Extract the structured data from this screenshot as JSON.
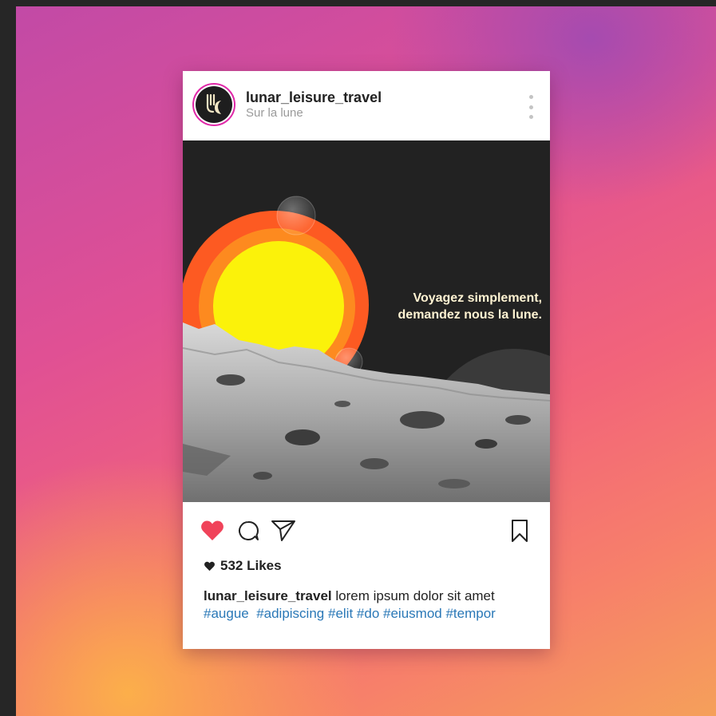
{
  "post": {
    "username": "lunar_leisure_travel",
    "location": "Sur la lune",
    "image": {
      "slogan_line1": "Voyagez simplement,",
      "slogan_line2": "demandez nous la lune."
    },
    "likes": "532 Likes",
    "caption": {
      "username": "lunar_leisure_travel",
      "text": "lorem ipsum dolor sit amet",
      "hashtags": [
        "#augue",
        "#adipiscing",
        "#elit",
        "#do",
        "#eiusmod",
        "#tempor"
      ]
    }
  },
  "icons": {
    "more": "more-vertical-icon",
    "like": "heart-icon",
    "comment": "comment-icon",
    "share": "send-icon",
    "save": "bookmark-icon",
    "likes_marker": "heart-small-icon"
  },
  "colors": {
    "like_active": "#f0435a",
    "hashtag": "#2a78b7",
    "avatar_ring": "#e028a8",
    "sun_core": "#fbf20a",
    "sun_ring_inner": "#fd8a1f",
    "sun_ring_outer": "#fd5a22"
  }
}
